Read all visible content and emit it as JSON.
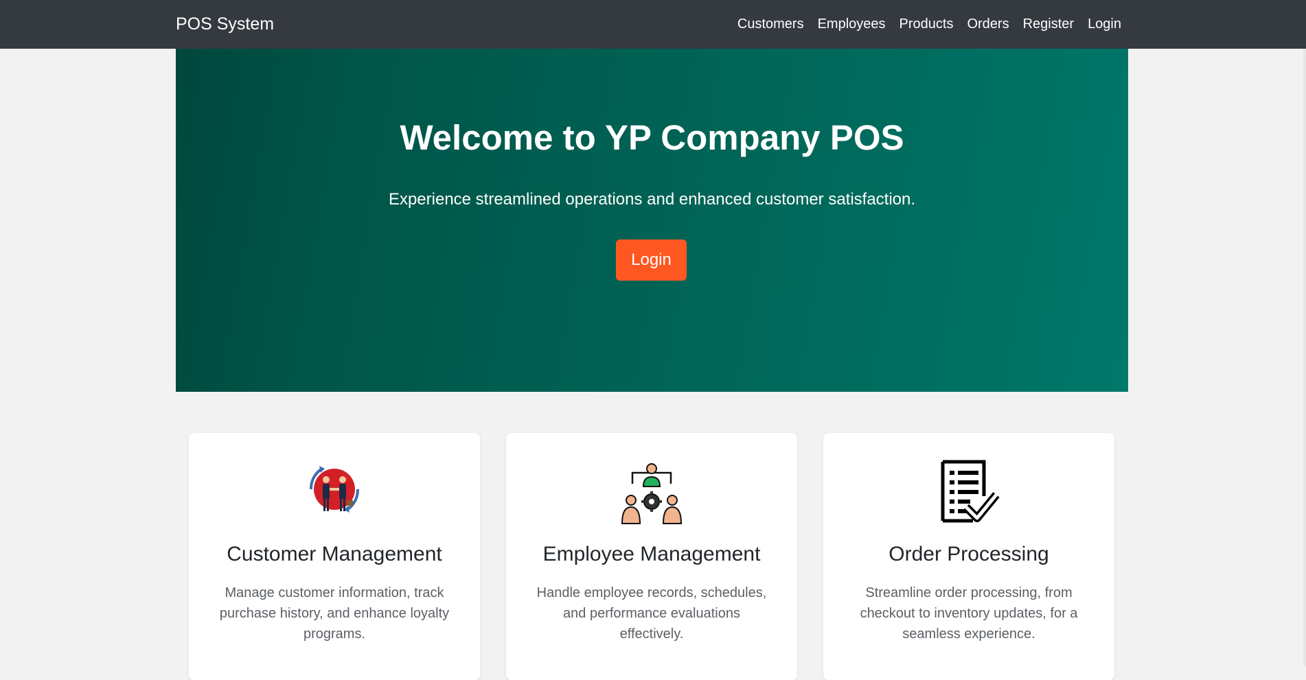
{
  "nav": {
    "brand": "POS System",
    "links": [
      "Customers",
      "Employees",
      "Products",
      "Orders",
      "Register",
      "Login"
    ]
  },
  "hero": {
    "title": "Welcome to YP Company POS",
    "subtitle": "Experience streamlined operations and enhanced customer satisfaction.",
    "button_label": "Login"
  },
  "features": [
    {
      "icon": "handshake-icon",
      "title": "Customer Management",
      "description": "Manage customer information, track purchase history, and enhance loyalty programs."
    },
    {
      "icon": "team-gear-icon",
      "title": "Employee Management",
      "description": "Handle employee records, schedules, and performance evaluations effectively."
    },
    {
      "icon": "checklist-icon",
      "title": "Order Processing",
      "description": "Streamline order processing, from checkout to inventory updates, for a seamless experience."
    }
  ],
  "colors": {
    "navbar": "#343a40",
    "hero_start": "#00473d",
    "hero_end": "#00786a",
    "accent_button": "#ff5722"
  }
}
